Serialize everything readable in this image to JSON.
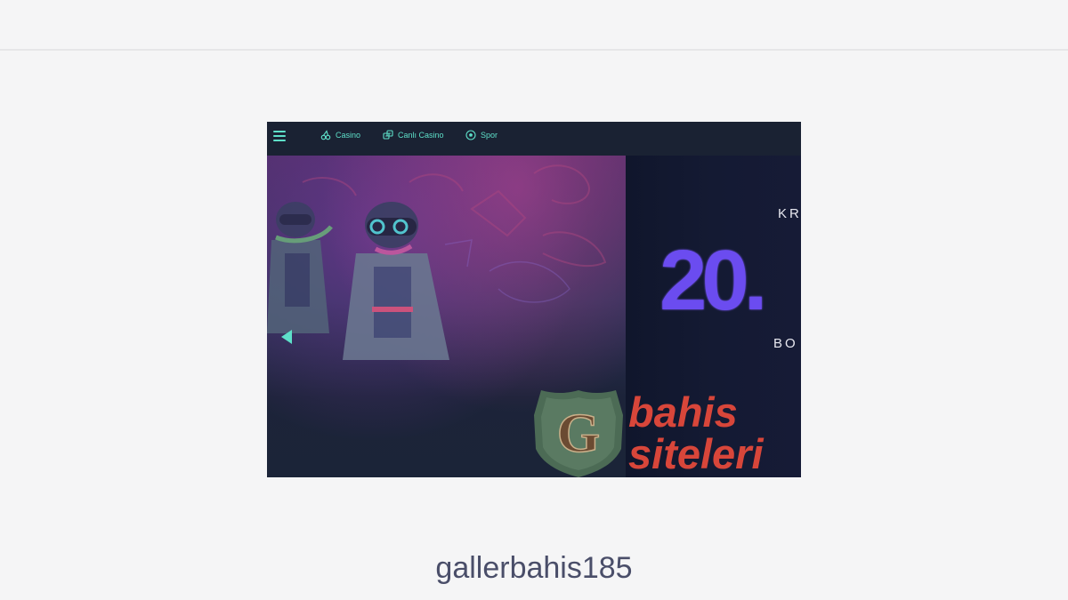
{
  "nav": {
    "items": [
      {
        "label": "Casino",
        "icon": "cherries-icon"
      },
      {
        "label": "Canlı Casino",
        "icon": "dice-icon"
      },
      {
        "label": "Spor",
        "icon": "soccer-ball-icon"
      }
    ]
  },
  "banner": {
    "top_text": "KR",
    "amount": "20.",
    "bottom_text": "BO"
  },
  "watermark": {
    "logo_letter": "G",
    "line1": "bahis",
    "line2": "siteleri"
  },
  "caption": "gallerbahis185",
  "colors": {
    "accent": "#5ee0c9",
    "amount": "#6b4cf0",
    "watermark_text": "#d8463a",
    "nav_bg": "#1a2233"
  }
}
